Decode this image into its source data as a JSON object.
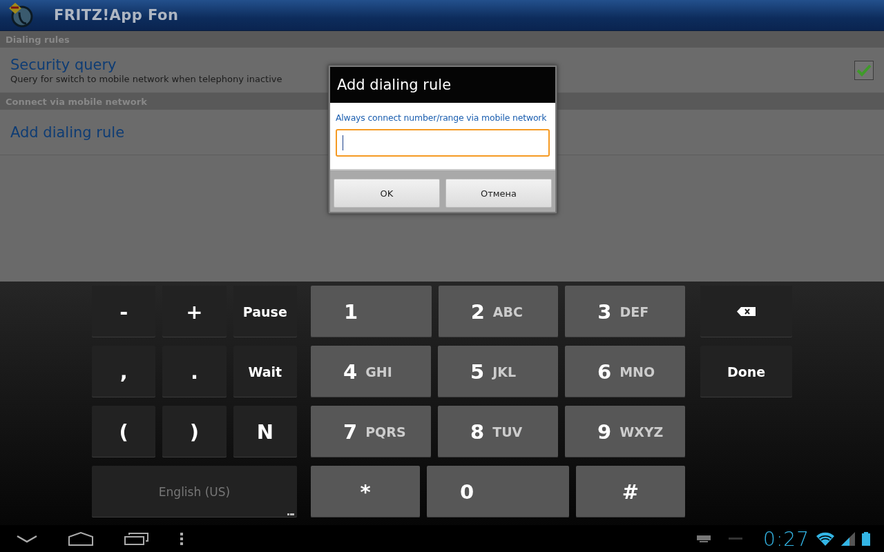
{
  "app_bar": {
    "title": "FRITZ!App Fon"
  },
  "sections": [
    {
      "header": "Dialing rules",
      "items": [
        {
          "kind": "checkbox",
          "title": "Security query",
          "summary": "Query for switch to mobile network when telephony inactive",
          "checked": true
        }
      ]
    },
    {
      "header": "Connect via mobile network",
      "items": [
        {
          "kind": "action",
          "title": "Add dialing rule"
        }
      ]
    }
  ],
  "dialog": {
    "title": "Add dialing rule",
    "label": "Always connect number/range via mobile network",
    "field": {
      "focused": true
    },
    "buttons": [
      "OK",
      "Отмена"
    ]
  },
  "keyboard": {
    "rows": [
      {
        "left": [
          {
            "kind": "symbol",
            "label": "-"
          },
          {
            "kind": "symbol",
            "label": "+"
          },
          {
            "kind": "word",
            "label": "Pause"
          }
        ],
        "middle": [
          {
            "kind": "digit",
            "label": "1"
          },
          {
            "kind": "digit",
            "label": "2",
            "letters": "ABC"
          },
          {
            "kind": "digit",
            "label": "3",
            "letters": "DEF"
          }
        ],
        "right": [
          {
            "kind": "backspace"
          }
        ]
      },
      {
        "left": [
          {
            "kind": "symbol",
            "label": ","
          },
          {
            "kind": "symbol",
            "label": "."
          },
          {
            "kind": "word",
            "label": "Wait"
          }
        ],
        "middle": [
          {
            "kind": "digit",
            "label": "4",
            "letters": "GHI"
          },
          {
            "kind": "digit",
            "label": "5",
            "letters": "JKL"
          },
          {
            "kind": "digit",
            "label": "6",
            "letters": "MNO"
          }
        ],
        "right": [
          {
            "kind": "word",
            "label": "Done"
          }
        ]
      },
      {
        "left": [
          {
            "kind": "symbol",
            "label": "("
          },
          {
            "kind": "symbol",
            "label": ")"
          },
          {
            "kind": "symbol",
            "label": "N"
          }
        ],
        "middle": [
          {
            "kind": "digit",
            "label": "7",
            "letters": "PQRS"
          },
          {
            "kind": "digit",
            "label": "8",
            "letters": "TUV"
          },
          {
            "kind": "digit",
            "label": "9",
            "letters": "WXYZ"
          }
        ]
      },
      {
        "left": [
          {
            "kind": "language",
            "label": "English (US)"
          }
        ],
        "middle": [
          {
            "kind": "symbol",
            "label": "*"
          },
          {
            "kind": "digit",
            "label": "0"
          },
          {
            "kind": "symbol",
            "label": "#"
          }
        ]
      }
    ]
  },
  "nav_bar": {
    "time": "0:27"
  }
}
